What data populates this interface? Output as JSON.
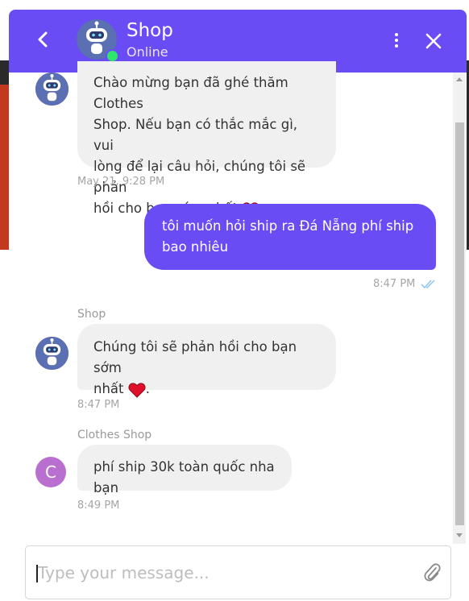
{
  "header": {
    "title": "Shop",
    "status": "Online",
    "accent_color": "#6a4cf5",
    "online_color": "#2ee66b",
    "icons": [
      "back-arrow-icon",
      "bot-avatar-icon",
      "more-vertical-icon",
      "close-icon"
    ]
  },
  "messages": [
    {
      "line1": "Chào mừng bạn đã ghé thăm Clothes",
      "line2": "Shop. Nếu bạn có thắc mắc gì, vui",
      "line3": "lòng để lại câu hỏi, chúng tôi sẽ phản",
      "line4": "hồi cho bạn sớm nhất",
      "time": "May 21, 9:28 PM"
    },
    {
      "line1": "tôi muốn hỏi ship ra Đá Nẵng phí ship",
      "line2": "bao nhiêu",
      "time": "8:47 PM"
    },
    {
      "sender": "Shop",
      "line1": "Chúng tôi sẽ phản hồi cho bạn sớm",
      "line2": "nhất",
      "line2_suffix": ".",
      "time": "8:47 PM"
    },
    {
      "sender": "Clothes Shop",
      "avatar_letter": "C",
      "line1": "phí ship 30k toàn quốc nha bạn",
      "time": "8:49 PM"
    }
  ],
  "composer": {
    "placeholder": "Type your message...",
    "icon": "paperclip-icon"
  }
}
